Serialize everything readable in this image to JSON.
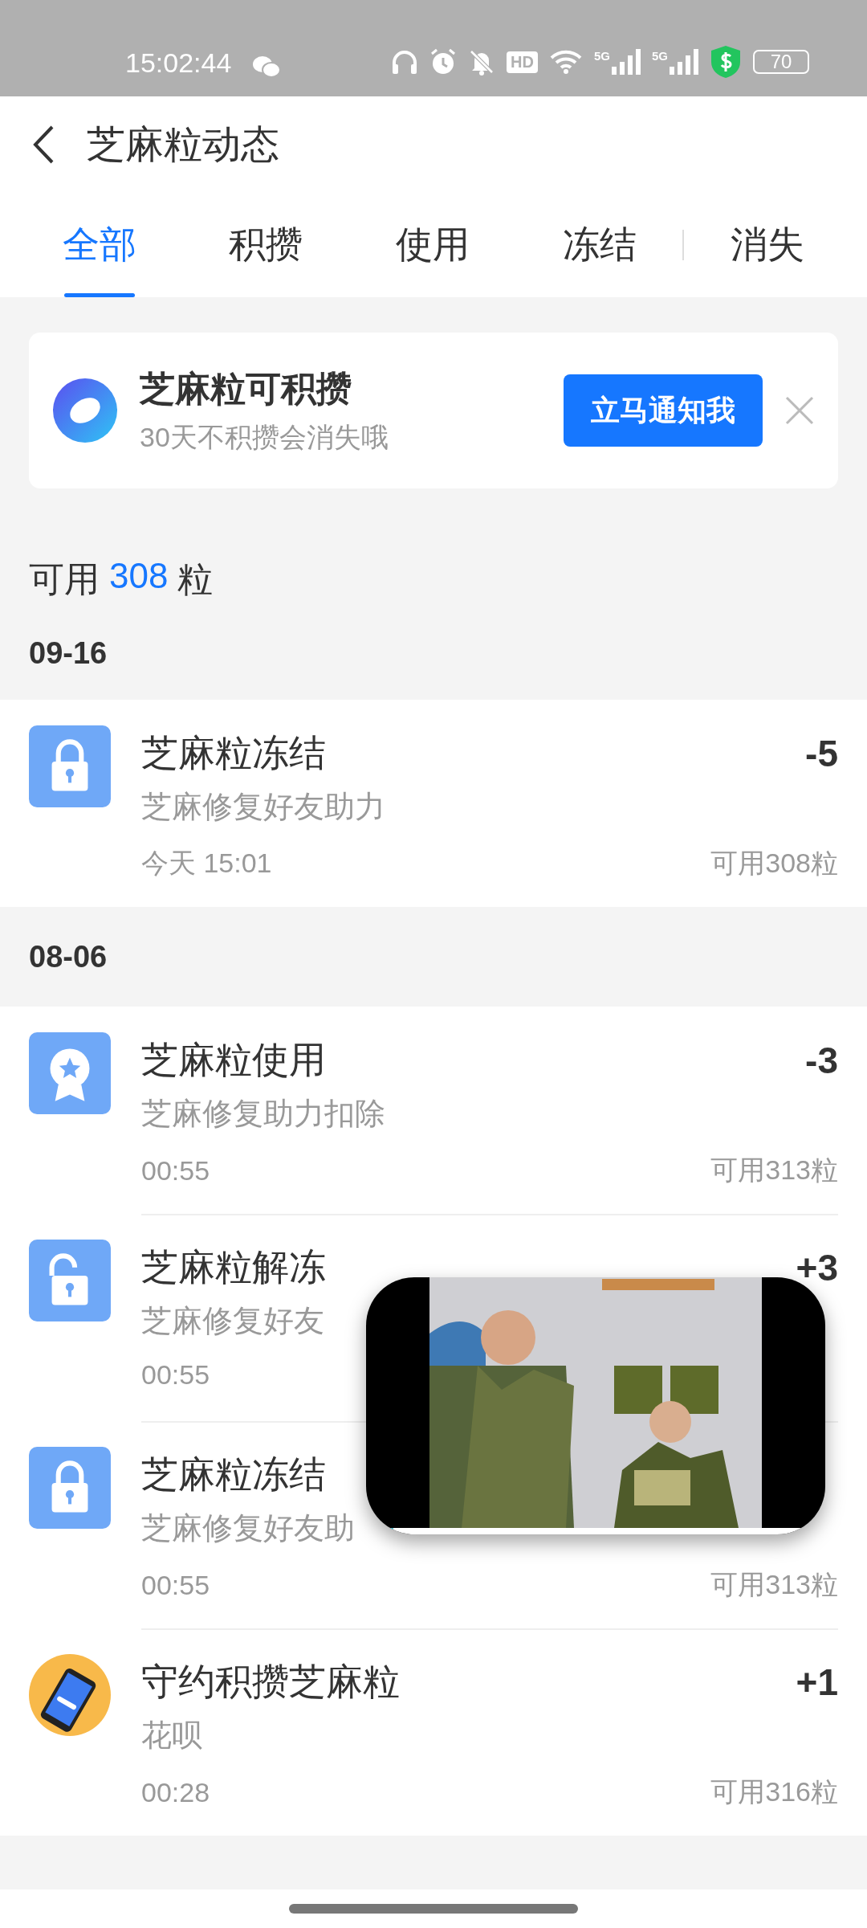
{
  "status_bar": {
    "time": "15:02:44",
    "hd": "HD",
    "signals": [
      "5G",
      "5G"
    ],
    "battery": "70"
  },
  "header": {
    "title": "芝麻粒动态"
  },
  "tabs": [
    {
      "label": "全部",
      "selected": true
    },
    {
      "label": "积攒",
      "selected": false
    },
    {
      "label": "使用",
      "selected": false
    },
    {
      "label": "冻结",
      "selected": false
    },
    {
      "label": "消失",
      "selected": false
    }
  ],
  "banner": {
    "title": "芝麻粒可积攒",
    "subtitle": "30天不积攒会消失哦",
    "button": "立马通知我"
  },
  "balance": {
    "prefix": "可用",
    "value": "308",
    "suffix": "粒"
  },
  "sections": [
    {
      "date": "09-16",
      "records": [
        {
          "kind": "lock",
          "title": "芝麻粒冻结",
          "subtitle": "芝麻修复好友助力",
          "time": "今天 15:01",
          "amount": "-5",
          "balance": "可用308粒"
        }
      ]
    },
    {
      "date": "08-06",
      "records": [
        {
          "kind": "award",
          "title": "芝麻粒使用",
          "subtitle": "芝麻修复助力扣除",
          "time": "00:55",
          "amount": "-3",
          "balance": "可用313粒"
        },
        {
          "kind": "unlock",
          "title": "芝麻粒解冻",
          "subtitle": "芝麻修复好友",
          "time": "00:55",
          "amount": "+3"
        },
        {
          "kind": "lock",
          "title": "芝麻粒冻结",
          "subtitle": "芝麻修复好友助",
          "time": "00:55",
          "balance": "可用313粒"
        },
        {
          "kind": "avatar",
          "title": "守约积攒芝麻粒",
          "subtitle": "花呗",
          "time": "00:28",
          "amount": "+1",
          "balance": "可用316粒"
        }
      ]
    }
  ],
  "video": {
    "kind": "picture",
    "level": 0.06
  }
}
